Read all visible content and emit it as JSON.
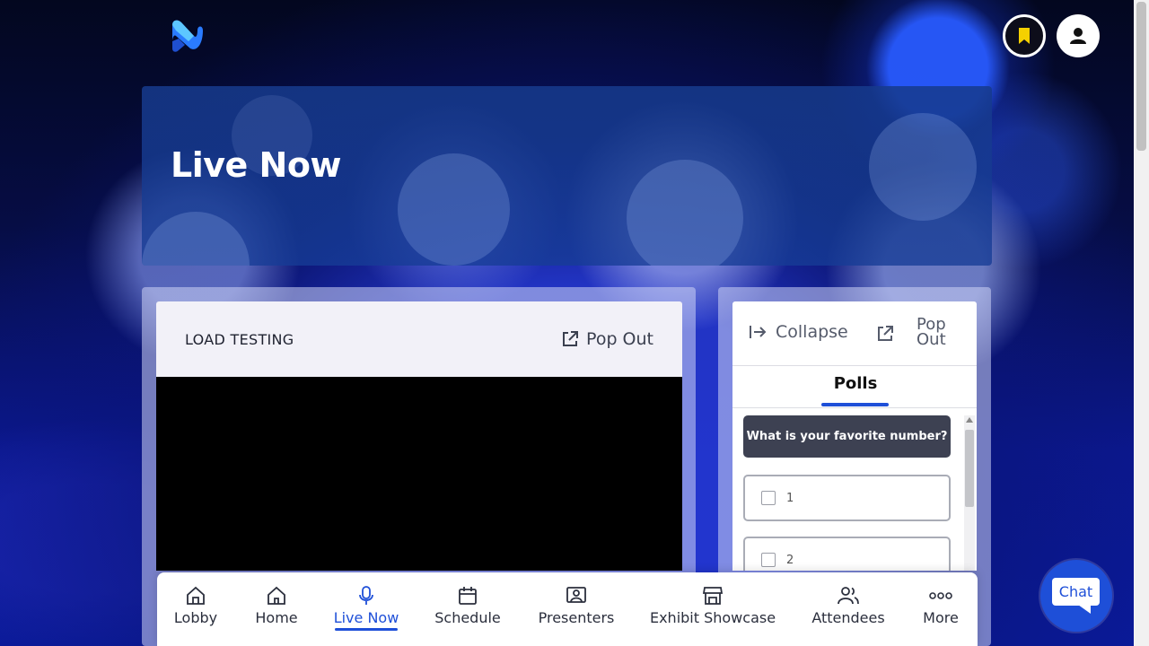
{
  "hero": {
    "title": "Live Now"
  },
  "stream": {
    "title": "LOAD TESTING",
    "popout_label": "Pop Out"
  },
  "side_panel": {
    "collapse_label": "Collapse",
    "popout_label": "Pop Out",
    "tab_label": "Polls",
    "poll": {
      "question": "What is your favorite number?",
      "options": [
        "1",
        "2"
      ]
    }
  },
  "nav": {
    "items": [
      {
        "label": "Lobby",
        "icon": "lobby-icon"
      },
      {
        "label": "Home",
        "icon": "home-icon"
      },
      {
        "label": "Live Now",
        "icon": "microphone-icon",
        "active": true
      },
      {
        "label": "Schedule",
        "icon": "calendar-icon"
      },
      {
        "label": "Presenters",
        "icon": "presenter-icon"
      },
      {
        "label": "Exhibit Showcase",
        "icon": "storefront-icon"
      },
      {
        "label": "Attendees",
        "icon": "people-icon"
      },
      {
        "label": "More",
        "icon": "more-icon"
      }
    ]
  },
  "chat": {
    "label": "Chat"
  },
  "colors": {
    "accent": "#1e4fd8",
    "question_bg": "#3d4152",
    "bookmark": "#f5d000"
  }
}
